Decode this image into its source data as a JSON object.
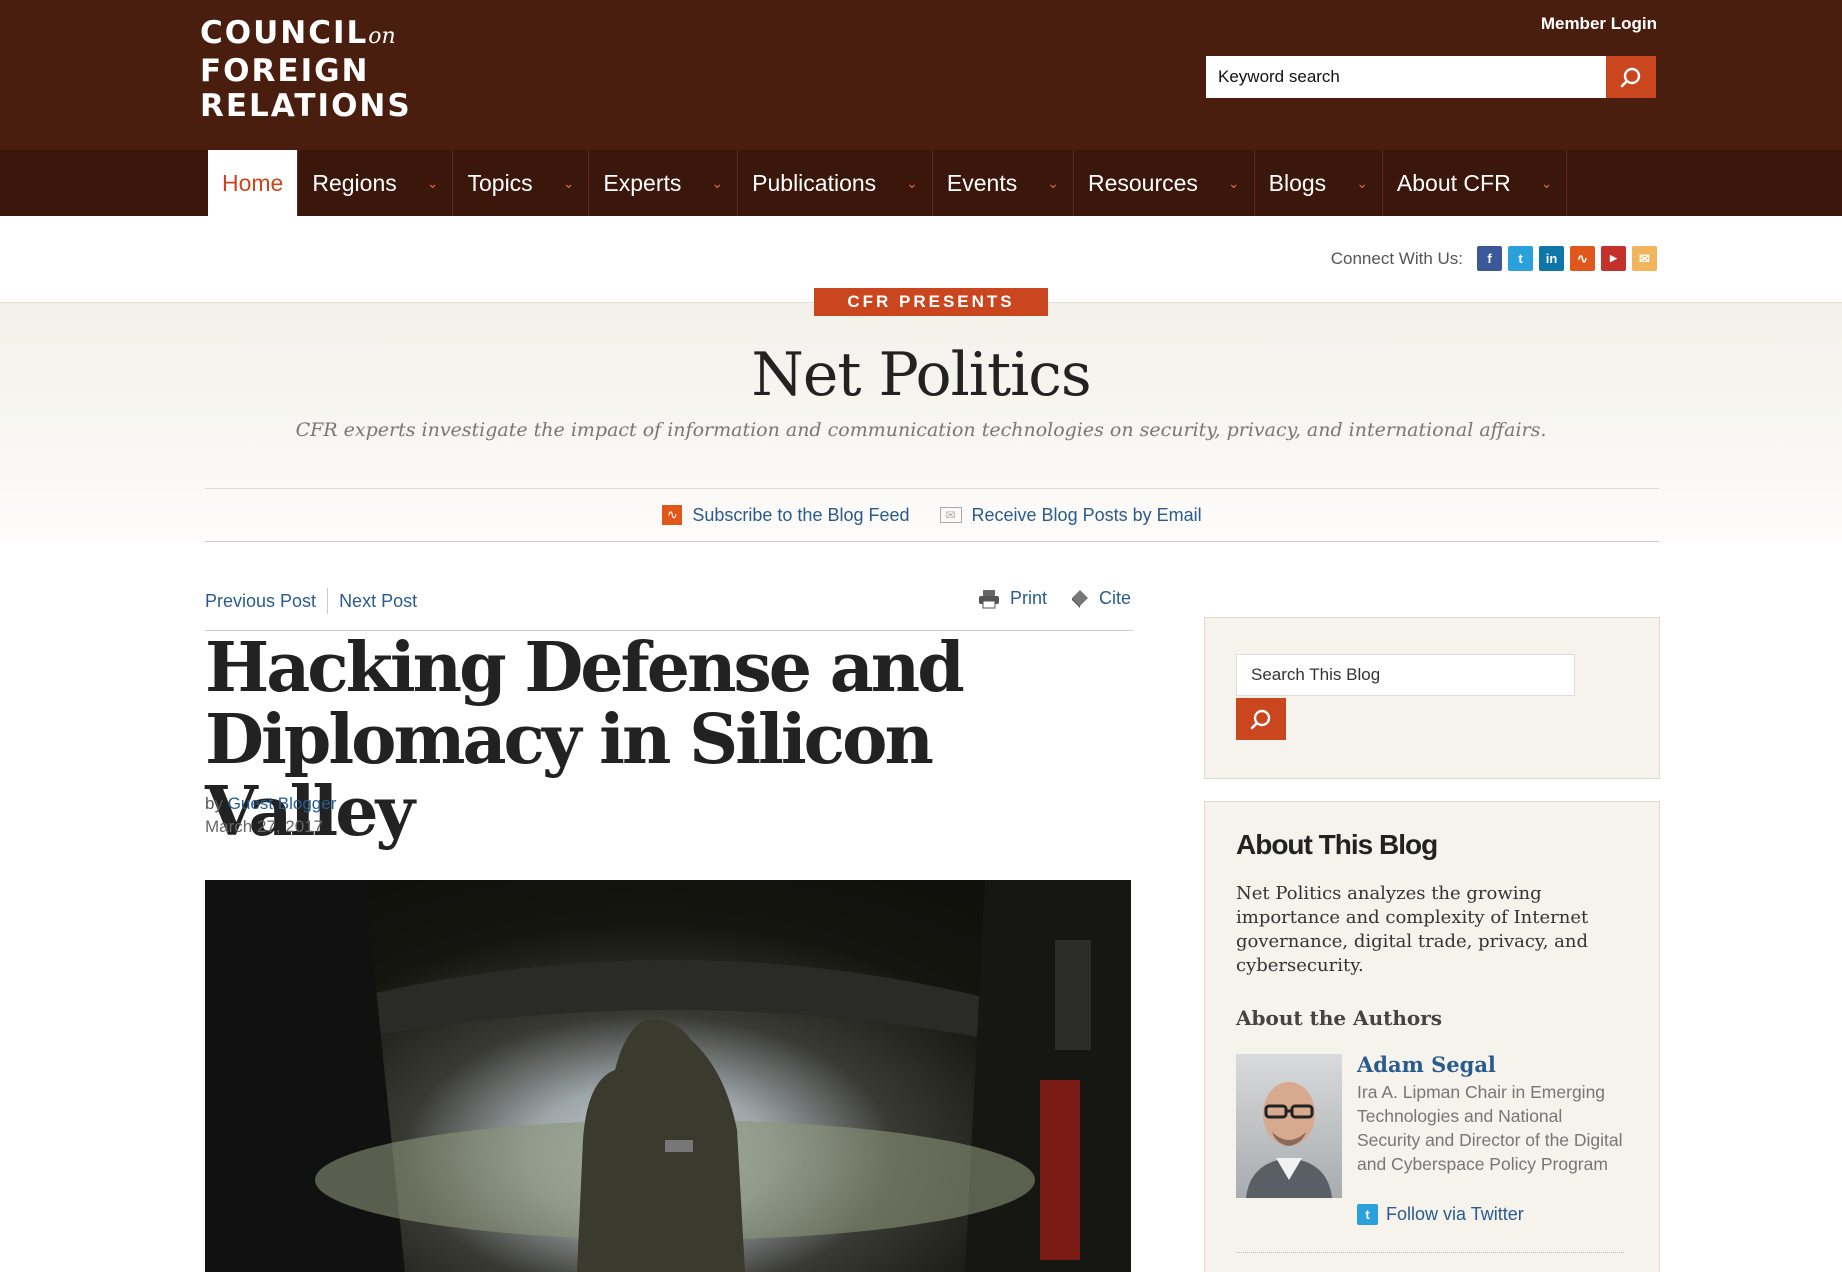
{
  "header": {
    "logo": {
      "line1": "COUNCIL",
      "on": "on",
      "line2": "FOREIGN",
      "line3": "RELATIONS"
    },
    "member_login": "Member Login",
    "search_placeholder": "Keyword search"
  },
  "nav": {
    "items": [
      {
        "label": "Home"
      },
      {
        "label": "Regions"
      },
      {
        "label": "Topics"
      },
      {
        "label": "Experts"
      },
      {
        "label": "Publications"
      },
      {
        "label": "Events"
      },
      {
        "label": "Resources"
      },
      {
        "label": "Blogs"
      },
      {
        "label": "About CFR"
      }
    ]
  },
  "connect": {
    "label": "Connect With Us:",
    "icons": [
      "facebook-icon",
      "twitter-icon",
      "linkedin-icon",
      "rss-icon",
      "youtube-icon",
      "email-icon"
    ]
  },
  "blog": {
    "presents": "CFR PRESENTS",
    "title": "Net Politics",
    "subtitle": "CFR experts investigate the impact of information and communication technologies on security, privacy, and international affairs.",
    "subscribe": "Subscribe to the Blog Feed",
    "email": "Receive Blog Posts by Email"
  },
  "article": {
    "prev": "Previous Post",
    "next": "Next Post",
    "print": "Print",
    "cite": "Cite",
    "title": "Hacking Defense and Diplomacy in Silicon Valley",
    "by": "by",
    "author": "Guest Blogger",
    "date": "March 27, 2017"
  },
  "sidebar": {
    "search_placeholder": "Search This Blog",
    "about_heading": "About This Blog",
    "about_text": "Net Politics analyzes the growing importance and complexity of Internet governance, digital trade, privacy, and cybersecurity.",
    "authors_heading": "About the Authors",
    "author_name": "Adam Segal",
    "author_role": "Ira A. Lipman Chair in Emerging Technologies and National Security and Director of the Digital and Cyberspace Policy Program",
    "follow": "Follow via Twitter"
  },
  "colors": {
    "brand_dark": "#4a1e0e",
    "nav_bg": "#3b160a",
    "accent": "#c9461e",
    "link": "#2a5b8e"
  }
}
